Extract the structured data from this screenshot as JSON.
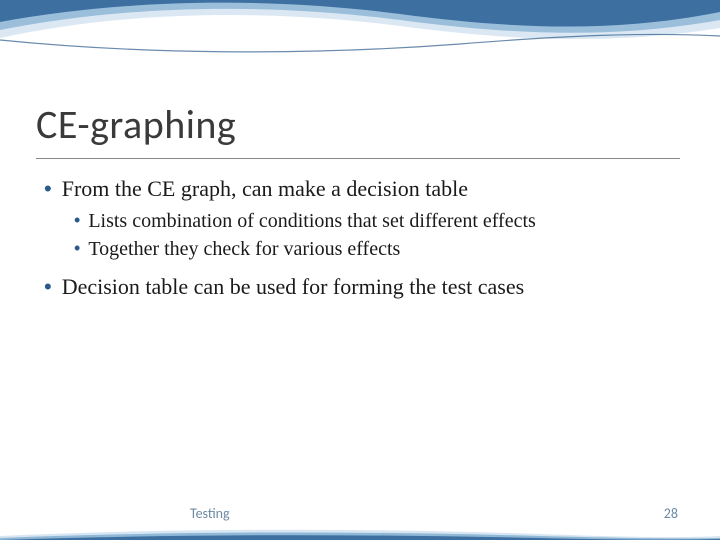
{
  "title": "CE-graphing",
  "bullets": [
    {
      "level": 1,
      "text": "From the CE graph, can make a decision table",
      "children": [
        {
          "level": 2,
          "text": "Lists combination of conditions that set different effects"
        },
        {
          "level": 2,
          "text": "Together they check for various effects"
        }
      ]
    },
    {
      "level": 1,
      "text": "Decision table can be used for forming the test cases",
      "children": []
    }
  ],
  "footer": {
    "label": "Testing",
    "page": "28"
  },
  "colors": {
    "bullet": "#2b5a8a",
    "footer": "#6d8aa5",
    "text": "#1a1a1a"
  }
}
